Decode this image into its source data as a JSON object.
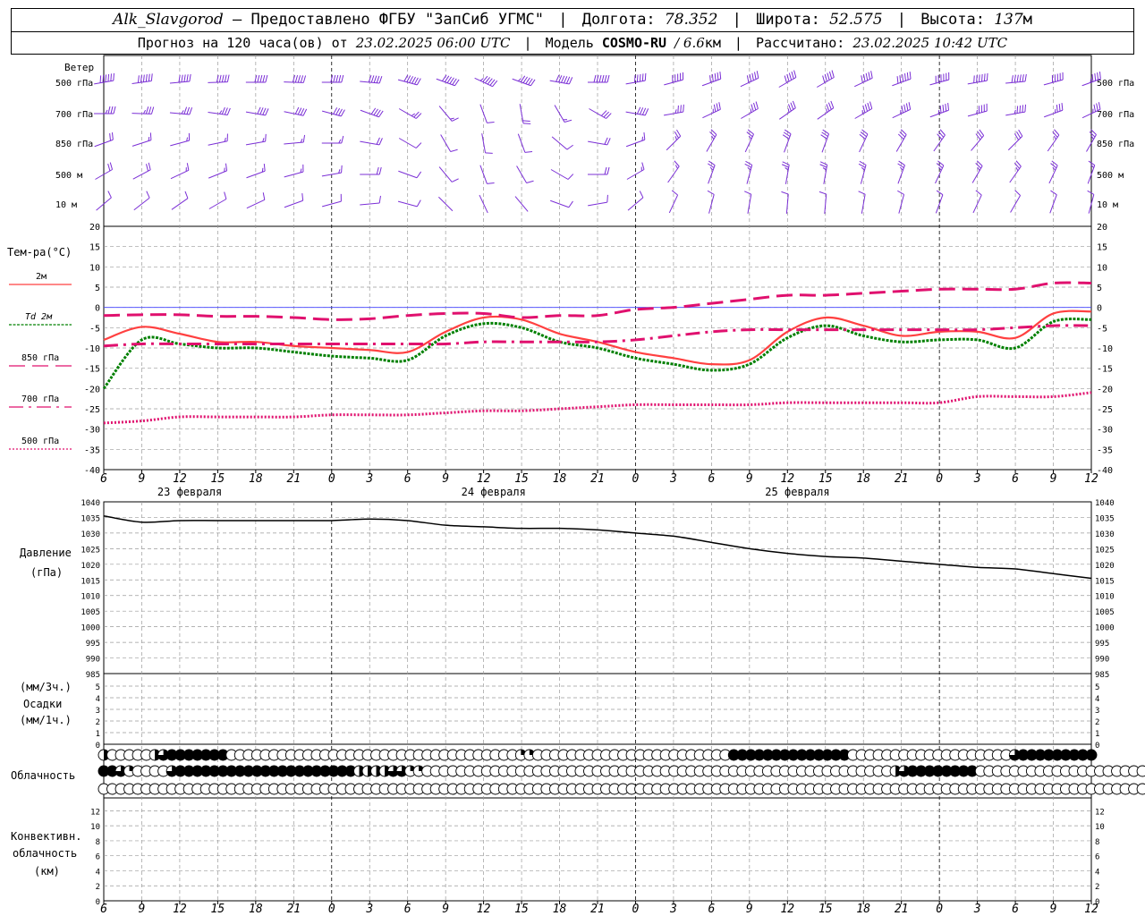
{
  "header": {
    "station": "Alk_Slavgorod",
    "provider": "— Предоставлено ФГБУ \"ЗапСиб УГМС\"",
    "lon_label": "Долгота:",
    "lon_value": "78.352",
    "lat_label": "Широта:",
    "lat_value": "52.575",
    "alt_label": "Высота:",
    "alt_value": "137",
    "alt_unit": "м",
    "forecast_prefix": "Прогноз на 120 часа(ов) от",
    "forecast_start": "23.02.2025 06:00 UTC",
    "model_label": "Модель",
    "model_name": "COSMO-RU",
    "model_res": "/ 6.6",
    "model_res_unit": "км",
    "calc_label": "Рассчитано:",
    "calc_time": "23.02.2025 10:42 UTC"
  },
  "labels": {
    "wind": "Ветер",
    "wind_levels": [
      "500 гПа",
      "700 гПа",
      "850 гПа",
      "500 м",
      "10  м"
    ],
    "temp_title": "Тем-ра(°С)",
    "temp_legend": [
      "2м",
      "Td 2м",
      "850 гПа",
      "700 гПа",
      "500 гПа"
    ],
    "pressure_title": "Давление",
    "pressure_unit": "(гПа)",
    "precip_unit_3h": "(мм/3ч.)",
    "precip_title": "Осадки",
    "precip_unit_1h": "(мм/1ч.)",
    "cloud_title": "Облачность",
    "conv_title_1": "Конвективн.",
    "conv_title_2": "облачность",
    "conv_unit": "(км)",
    "dates": [
      "23 февраля",
      "24 февраля",
      "25 февраля"
    ]
  },
  "colors": {
    "t2m": "#ff4040",
    "td2m": "#008000",
    "t850": "#e0106e",
    "t700": "#e0106e",
    "t500": "#e0106e",
    "wind": "#7b2fd6",
    "zero_line": "#4040ff",
    "pressure": "#000000",
    "grid": "#9a9a9a"
  },
  "chart_data": [
    {
      "type": "line",
      "title": "Тем-ра(°С)",
      "x_hours": [
        0,
        3,
        6,
        9,
        12,
        15,
        18,
        21,
        24,
        27,
        30,
        33,
        36,
        39,
        42,
        45,
        48,
        51,
        54,
        57,
        60,
        63,
        66,
        69,
        72,
        75,
        78
      ],
      "x_ticks": [
        "6",
        "9",
        "12",
        "15",
        "18",
        "21",
        "0",
        "3",
        "6",
        "9",
        "12",
        "15",
        "18",
        "21",
        "0",
        "3",
        "6",
        "9",
        "12",
        "15",
        "18",
        "21",
        "0",
        "3",
        "6",
        "9",
        "12"
      ],
      "ylim": [
        -40,
        20
      ],
      "yticks": [
        -40,
        -35,
        -30,
        -25,
        -20,
        -15,
        -10,
        -5,
        0,
        5,
        10,
        15,
        20
      ],
      "series": [
        {
          "name": "2м",
          "style": "solid",
          "values": [
            -8,
            -4.8,
            -6.5,
            -8.5,
            -8.5,
            -9.5,
            -10,
            -10.5,
            -11,
            -6,
            -2.5,
            -3,
            -6.5,
            -8.5,
            -11,
            -12.5,
            -14,
            -13,
            -6,
            -2.5,
            -4.5,
            -7,
            -6,
            -6,
            -7.5,
            -1.5,
            -1
          ]
        },
        {
          "name": "Td 2м",
          "style": "dotted",
          "values": [
            -20,
            -8,
            -9,
            -10,
            -10,
            -11,
            -12,
            -12.5,
            -13,
            -7,
            -4,
            -5,
            -8.5,
            -10,
            -12.5,
            -14,
            -15.5,
            -14,
            -7.5,
            -4.5,
            -7,
            -8.5,
            -8,
            -8,
            -10,
            -3.5,
            -3
          ]
        },
        {
          "name": "850 гПа",
          "style": "dashed",
          "values": [
            -2,
            -1.8,
            -1.8,
            -2.2,
            -2.2,
            -2.5,
            -3,
            -2.8,
            -2,
            -1.5,
            -1.5,
            -2.5,
            -2,
            -2,
            -0.5,
            0,
            1,
            2,
            3,
            3,
            3.5,
            4,
            4.5,
            4.5,
            4.5,
            6,
            6
          ]
        },
        {
          "name": "700 гПа",
          "style": "dashdot",
          "values": [
            -9.5,
            -9,
            -9,
            -9,
            -9,
            -9,
            -9,
            -9,
            -9,
            -9,
            -8.5,
            -8.5,
            -8.5,
            -8.5,
            -8,
            -7,
            -6,
            -5.5,
            -5.5,
            -5.5,
            -5.5,
            -5.5,
            -5.5,
            -5.5,
            -5,
            -4.5,
            -4.5
          ]
        },
        {
          "name": "500 гПа",
          "style": "fine-dotted",
          "values": [
            -28.5,
            -28,
            -27,
            -27,
            -27,
            -27,
            -26.5,
            -26.5,
            -26.5,
            -26,
            -25.5,
            -25.5,
            -25,
            -24.5,
            -24,
            -24,
            -24,
            -24,
            -23.5,
            -23.5,
            -23.5,
            -23.5,
            -23.5,
            -22,
            -22,
            -22,
            -21
          ]
        }
      ]
    },
    {
      "type": "line",
      "title": "Давление",
      "x_hours": [
        0,
        3,
        6,
        9,
        12,
        15,
        18,
        21,
        24,
        27,
        30,
        33,
        36,
        39,
        42,
        45,
        48,
        51,
        54,
        57,
        60,
        63,
        66,
        69,
        72,
        75,
        78
      ],
      "ylim": [
        985,
        1040
      ],
      "yticks": [
        985,
        990,
        995,
        1000,
        1005,
        1010,
        1015,
        1020,
        1025,
        1030,
        1035,
        1040
      ],
      "series": [
        {
          "name": "Давление",
          "values": [
            1035.5,
            1033.5,
            1034,
            1034,
            1034,
            1034,
            1034,
            1034.5,
            1034,
            1032.5,
            1032,
            1031.5,
            1031.5,
            1031,
            1030,
            1029,
            1027,
            1025,
            1023.5,
            1022.5,
            1022,
            1021,
            1020,
            1019,
            1018.5,
            1017,
            1015.5
          ]
        }
      ]
    },
    {
      "type": "bar",
      "title": "Осадки",
      "ylim": [
        0,
        5
      ],
      "yticks": [
        0,
        1,
        2,
        3,
        4,
        5
      ],
      "values": []
    },
    {
      "type": "table",
      "title": "Облачность",
      "rows": [
        {
          "name": "high",
          "values": [
            2,
            0,
            0,
            0,
            0,
            0,
            2,
            3,
            4,
            4,
            4,
            4,
            4,
            4,
            4,
            0,
            0,
            0,
            0,
            0,
            0,
            0,
            0,
            0,
            0,
            0,
            0,
            0,
            0,
            0,
            0,
            0,
            0,
            0,
            0,
            0,
            0,
            0,
            0,
            0,
            0,
            0,
            0,
            0,
            0,
            0,
            0,
            0,
            0,
            1,
            1,
            0,
            0,
            0,
            0,
            0,
            0,
            0,
            0,
            0,
            0,
            0,
            0,
            0,
            0,
            0,
            0,
            0,
            0,
            0,
            0,
            0,
            0,
            0,
            4,
            4,
            4,
            4,
            4,
            4,
            4,
            4,
            4,
            4,
            4,
            4,
            4,
            4,
            0,
            0,
            0,
            0,
            0,
            0,
            0,
            0,
            0,
            0,
            0,
            0,
            0,
            0,
            0,
            0,
            0,
            0,
            0,
            3,
            4,
            4,
            4,
            4,
            4,
            4,
            4,
            4,
            4
          ]
        },
        {
          "name": "mid",
          "values": [
            4,
            4,
            3,
            1,
            0,
            0,
            0,
            0,
            3,
            4,
            4,
            4,
            4,
            4,
            4,
            4,
            4,
            4,
            4,
            4,
            4,
            4,
            4,
            4,
            4,
            4,
            4,
            4,
            4,
            4,
            2,
            2,
            2,
            2,
            3,
            3,
            1,
            1,
            0,
            0,
            0,
            0,
            0,
            0,
            0,
            0,
            0,
            0,
            0,
            0,
            0,
            0,
            0,
            0,
            0,
            0,
            0,
            0,
            0,
            0,
            0,
            0,
            0,
            0,
            0,
            0,
            0,
            0,
            0,
            0,
            0,
            0,
            0,
            0,
            0,
            0,
            0,
            0,
            0,
            0,
            0,
            0,
            0,
            0,
            0,
            0,
            0,
            0,
            0,
            0,
            0,
            0,
            0,
            2,
            3,
            4,
            4,
            4,
            4,
            4,
            4,
            4,
            4,
            0,
            0,
            0,
            0,
            0,
            0,
            0,
            0,
            0,
            0,
            0,
            0,
            0,
            0,
            0,
            0,
            0,
            0,
            0,
            0,
            0,
            0
          ]
        },
        {
          "name": "low",
          "values": [
            0,
            0,
            0,
            0,
            0,
            0,
            0,
            0,
            0,
            0,
            0,
            0,
            0,
            0,
            0,
            0,
            0,
            0,
            0,
            0,
            0,
            0,
            0,
            0,
            0,
            0,
            0,
            0,
            0,
            0,
            0,
            0,
            0,
            0,
            0,
            0,
            0,
            0,
            0,
            0,
            0,
            0,
            0,
            0,
            0,
            0,
            0,
            0,
            0,
            0,
            0,
            0,
            0,
            0,
            0,
            0,
            0,
            0,
            0,
            0,
            0,
            0,
            0,
            0,
            0,
            0,
            0,
            0,
            0,
            0,
            0,
            0,
            0,
            0,
            0,
            0,
            0,
            0,
            0,
            0,
            0,
            0,
            0,
            0,
            0,
            0,
            0,
            0,
            0,
            0,
            0,
            0,
            0,
            0,
            0,
            0,
            0,
            0,
            0,
            0,
            0,
            0,
            0,
            0,
            0,
            0,
            0,
            0,
            0,
            0,
            0,
            0,
            0,
            0,
            0,
            0,
            0,
            0,
            0,
            0,
            0,
            0,
            0,
            0,
            0
          ]
        }
      ]
    },
    {
      "type": "bar",
      "title": "Конвективн. облачность",
      "ylim": [
        0,
        13
      ],
      "yticks": [
        0,
        2,
        4,
        6,
        8,
        10,
        12
      ],
      "values": []
    },
    {
      "type": "wind_barbs",
      "title": "Ветер",
      "levels": [
        "500 гПа",
        "700 гПа",
        "850 гПа",
        "500 м",
        "10  м"
      ],
      "x_hours": [
        0,
        3,
        6,
        9,
        12,
        15,
        18,
        21,
        24,
        27,
        30,
        33,
        36,
        39,
        42,
        45,
        48,
        51,
        54,
        57,
        60,
        63,
        66,
        69,
        72,
        75,
        78
      ],
      "direction_deg": [
        [
          260,
          262,
          265,
          268,
          270,
          272,
          270,
          275,
          285,
          290,
          295,
          290,
          280,
          270,
          260,
          255,
          250,
          245,
          240,
          240,
          245,
          250,
          255,
          260,
          265,
          255,
          250
        ],
        [
          270,
          272,
          275,
          278,
          280,
          282,
          285,
          290,
          300,
          320,
          340,
          350,
          330,
          300,
          280,
          260,
          245,
          240,
          235,
          235,
          240,
          245,
          250,
          255,
          260,
          250,
          245
        ],
        [
          250,
          252,
          255,
          258,
          260,
          265,
          270,
          280,
          300,
          330,
          350,
          340,
          310,
          280,
          250,
          225,
          210,
          205,
          200,
          200,
          205,
          210,
          215,
          220,
          225,
          215,
          210
        ],
        [
          240,
          242,
          245,
          248,
          250,
          255,
          260,
          270,
          290,
          320,
          340,
          330,
          300,
          270,
          240,
          215,
          200,
          195,
          190,
          190,
          195,
          200,
          205,
          210,
          215,
          205,
          200
        ],
        [
          230,
          232,
          235,
          240,
          245,
          250,
          255,
          265,
          285,
          315,
          335,
          320,
          290,
          260,
          230,
          205,
          195,
          190,
          185,
          185,
          190,
          195,
          200,
          205,
          210,
          200,
          195
        ]
      ],
      "speed_ms": [
        [
          28,
          28,
          27,
          26,
          25,
          25,
          26,
          27,
          28,
          29,
          30,
          30,
          29,
          28,
          27,
          26,
          26,
          25,
          25,
          26,
          27,
          28,
          28,
          29,
          29,
          26,
          24
        ],
        [
          22,
          22,
          21,
          20,
          19,
          19,
          18,
          18,
          14,
          10,
          5,
          8,
          12,
          16,
          18,
          20,
          21,
          22,
          22,
          22,
          23,
          24,
          24,
          24,
          24,
          22,
          20
        ],
        [
          9,
          10,
          10,
          11,
          11,
          10,
          10,
          9,
          6,
          4,
          3,
          4,
          6,
          9,
          11,
          13,
          14,
          14,
          15,
          15,
          15,
          15,
          15,
          15,
          15,
          14,
          13
        ],
        [
          8,
          9,
          10,
          11,
          11,
          11,
          10,
          9,
          5,
          4,
          3,
          4,
          6,
          9,
          11,
          12,
          13,
          13,
          14,
          14,
          14,
          14,
          14,
          14,
          14,
          13,
          12
        ],
        [
          3,
          4,
          5,
          5,
          5,
          5,
          4,
          4,
          3,
          2,
          2,
          2,
          3,
          4,
          5,
          6,
          6,
          7,
          7,
          7,
          7,
          7,
          7,
          7,
          7,
          6,
          6
        ]
      ]
    }
  ]
}
